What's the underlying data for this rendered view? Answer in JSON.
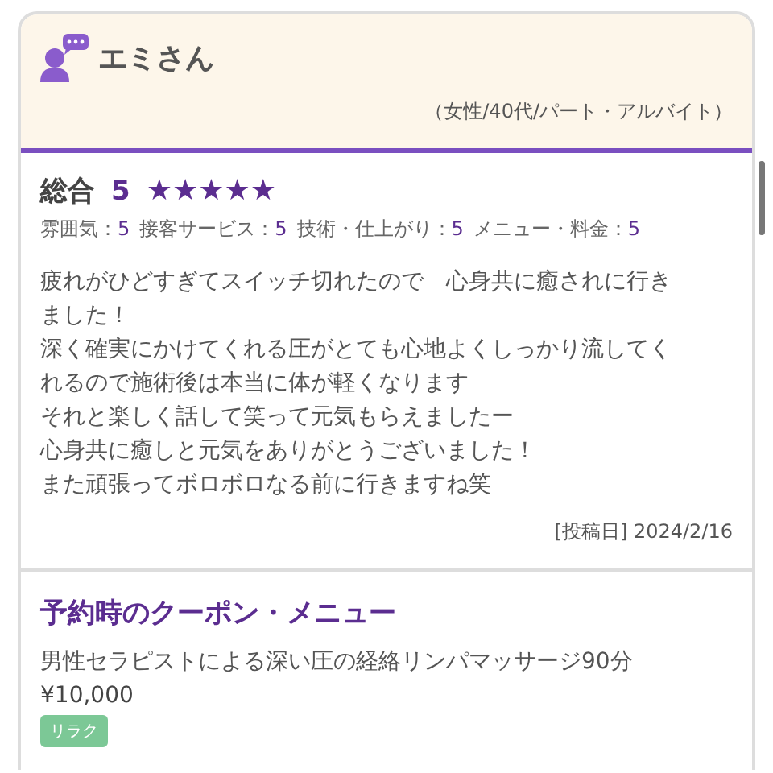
{
  "reviewer": {
    "name": "エミさん",
    "profile": "（女性/40代/パート・アルバイト）"
  },
  "overall": {
    "label": "総合",
    "score": "5",
    "stars": 5
  },
  "ratings": [
    {
      "label": "雰囲気：",
      "value": "5"
    },
    {
      "label": "接客サービス：",
      "value": "5"
    },
    {
      "label": "技術・仕上がり：",
      "value": "5"
    },
    {
      "label": "メニュー・料金：",
      "value": "5"
    }
  ],
  "comment_lines": [
    "疲れがひどすぎてスイッチ切れたので　心身共に癒されに行き",
    "ました！",
    "深く確実にかけてくれる圧がとても心地よくしっかり流してく",
    "れるので施術後は本当に体が軽くなります",
    "それと楽しく話して笑って元気もらえましたー",
    "心身共に癒しと元気をありがとうございました！",
    "また頑張ってボロボロなる前に行きますね笑"
  ],
  "posted": "[投稿日] 2024/2/16",
  "coupon": {
    "heading": "予約時のクーポン・メニュー",
    "name": "男性セラピストによる深い圧の経絡リンパマッサージ90分",
    "price": "¥10,000",
    "tag": "リラク"
  }
}
